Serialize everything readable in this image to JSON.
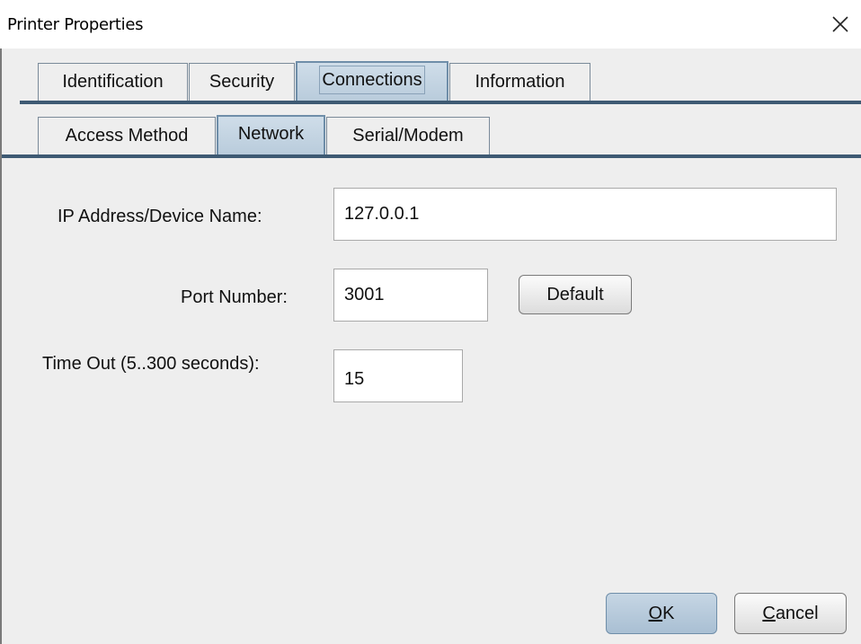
{
  "window": {
    "title": "Printer Properties",
    "close_icon": "close-icon"
  },
  "tabs_main": [
    {
      "label": "Identification",
      "active": false
    },
    {
      "label": "Security",
      "active": false
    },
    {
      "label": "Connections",
      "active": true
    },
    {
      "label": "Information",
      "active": false
    }
  ],
  "tabs_sub": [
    {
      "label": "Access Method",
      "active": false
    },
    {
      "label": "Network",
      "active": true
    },
    {
      "label": "Serial/Modem",
      "active": false
    }
  ],
  "form": {
    "ip_label": "IP Address/Device Name:",
    "ip_value": "127.0.0.1",
    "port_label": "Port Number:",
    "port_value": "3001",
    "default_button": "Default",
    "timeout_label": "Time Out (5..300 seconds):",
    "timeout_value": "15"
  },
  "footer": {
    "ok_mnemonic": "O",
    "ok_rest": "K",
    "cancel_mnemonic": "C",
    "cancel_rest": "ancel"
  },
  "colors": {
    "dialog_bg": "#eeeeee",
    "active_tab": "#c4d5e3",
    "tab_border": "#6f8ea9"
  }
}
